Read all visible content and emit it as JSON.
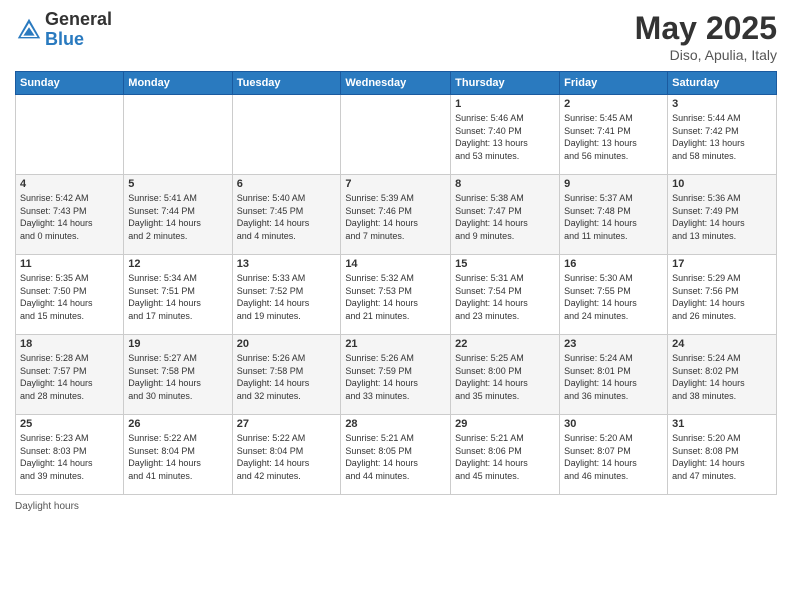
{
  "header": {
    "logo_general": "General",
    "logo_blue": "Blue",
    "main_title": "May 2025",
    "subtitle": "Diso, Apulia, Italy"
  },
  "days_of_week": [
    "Sunday",
    "Monday",
    "Tuesday",
    "Wednesday",
    "Thursday",
    "Friday",
    "Saturday"
  ],
  "weeks": [
    [
      {
        "num": "",
        "info": ""
      },
      {
        "num": "",
        "info": ""
      },
      {
        "num": "",
        "info": ""
      },
      {
        "num": "",
        "info": ""
      },
      {
        "num": "1",
        "info": "Sunrise: 5:46 AM\nSunset: 7:40 PM\nDaylight: 13 hours\nand 53 minutes."
      },
      {
        "num": "2",
        "info": "Sunrise: 5:45 AM\nSunset: 7:41 PM\nDaylight: 13 hours\nand 56 minutes."
      },
      {
        "num": "3",
        "info": "Sunrise: 5:44 AM\nSunset: 7:42 PM\nDaylight: 13 hours\nand 58 minutes."
      }
    ],
    [
      {
        "num": "4",
        "info": "Sunrise: 5:42 AM\nSunset: 7:43 PM\nDaylight: 14 hours\nand 0 minutes."
      },
      {
        "num": "5",
        "info": "Sunrise: 5:41 AM\nSunset: 7:44 PM\nDaylight: 14 hours\nand 2 minutes."
      },
      {
        "num": "6",
        "info": "Sunrise: 5:40 AM\nSunset: 7:45 PM\nDaylight: 14 hours\nand 4 minutes."
      },
      {
        "num": "7",
        "info": "Sunrise: 5:39 AM\nSunset: 7:46 PM\nDaylight: 14 hours\nand 7 minutes."
      },
      {
        "num": "8",
        "info": "Sunrise: 5:38 AM\nSunset: 7:47 PM\nDaylight: 14 hours\nand 9 minutes."
      },
      {
        "num": "9",
        "info": "Sunrise: 5:37 AM\nSunset: 7:48 PM\nDaylight: 14 hours\nand 11 minutes."
      },
      {
        "num": "10",
        "info": "Sunrise: 5:36 AM\nSunset: 7:49 PM\nDaylight: 14 hours\nand 13 minutes."
      }
    ],
    [
      {
        "num": "11",
        "info": "Sunrise: 5:35 AM\nSunset: 7:50 PM\nDaylight: 14 hours\nand 15 minutes."
      },
      {
        "num": "12",
        "info": "Sunrise: 5:34 AM\nSunset: 7:51 PM\nDaylight: 14 hours\nand 17 minutes."
      },
      {
        "num": "13",
        "info": "Sunrise: 5:33 AM\nSunset: 7:52 PM\nDaylight: 14 hours\nand 19 minutes."
      },
      {
        "num": "14",
        "info": "Sunrise: 5:32 AM\nSunset: 7:53 PM\nDaylight: 14 hours\nand 21 minutes."
      },
      {
        "num": "15",
        "info": "Sunrise: 5:31 AM\nSunset: 7:54 PM\nDaylight: 14 hours\nand 23 minutes."
      },
      {
        "num": "16",
        "info": "Sunrise: 5:30 AM\nSunset: 7:55 PM\nDaylight: 14 hours\nand 24 minutes."
      },
      {
        "num": "17",
        "info": "Sunrise: 5:29 AM\nSunset: 7:56 PM\nDaylight: 14 hours\nand 26 minutes."
      }
    ],
    [
      {
        "num": "18",
        "info": "Sunrise: 5:28 AM\nSunset: 7:57 PM\nDaylight: 14 hours\nand 28 minutes."
      },
      {
        "num": "19",
        "info": "Sunrise: 5:27 AM\nSunset: 7:58 PM\nDaylight: 14 hours\nand 30 minutes."
      },
      {
        "num": "20",
        "info": "Sunrise: 5:26 AM\nSunset: 7:58 PM\nDaylight: 14 hours\nand 32 minutes."
      },
      {
        "num": "21",
        "info": "Sunrise: 5:26 AM\nSunset: 7:59 PM\nDaylight: 14 hours\nand 33 minutes."
      },
      {
        "num": "22",
        "info": "Sunrise: 5:25 AM\nSunset: 8:00 PM\nDaylight: 14 hours\nand 35 minutes."
      },
      {
        "num": "23",
        "info": "Sunrise: 5:24 AM\nSunset: 8:01 PM\nDaylight: 14 hours\nand 36 minutes."
      },
      {
        "num": "24",
        "info": "Sunrise: 5:24 AM\nSunset: 8:02 PM\nDaylight: 14 hours\nand 38 minutes."
      }
    ],
    [
      {
        "num": "25",
        "info": "Sunrise: 5:23 AM\nSunset: 8:03 PM\nDaylight: 14 hours\nand 39 minutes."
      },
      {
        "num": "26",
        "info": "Sunrise: 5:22 AM\nSunset: 8:04 PM\nDaylight: 14 hours\nand 41 minutes."
      },
      {
        "num": "27",
        "info": "Sunrise: 5:22 AM\nSunset: 8:04 PM\nDaylight: 14 hours\nand 42 minutes."
      },
      {
        "num": "28",
        "info": "Sunrise: 5:21 AM\nSunset: 8:05 PM\nDaylight: 14 hours\nand 44 minutes."
      },
      {
        "num": "29",
        "info": "Sunrise: 5:21 AM\nSunset: 8:06 PM\nDaylight: 14 hours\nand 45 minutes."
      },
      {
        "num": "30",
        "info": "Sunrise: 5:20 AM\nSunset: 8:07 PM\nDaylight: 14 hours\nand 46 minutes."
      },
      {
        "num": "31",
        "info": "Sunrise: 5:20 AM\nSunset: 8:08 PM\nDaylight: 14 hours\nand 47 minutes."
      }
    ]
  ],
  "footer": {
    "daylight_label": "Daylight hours"
  }
}
